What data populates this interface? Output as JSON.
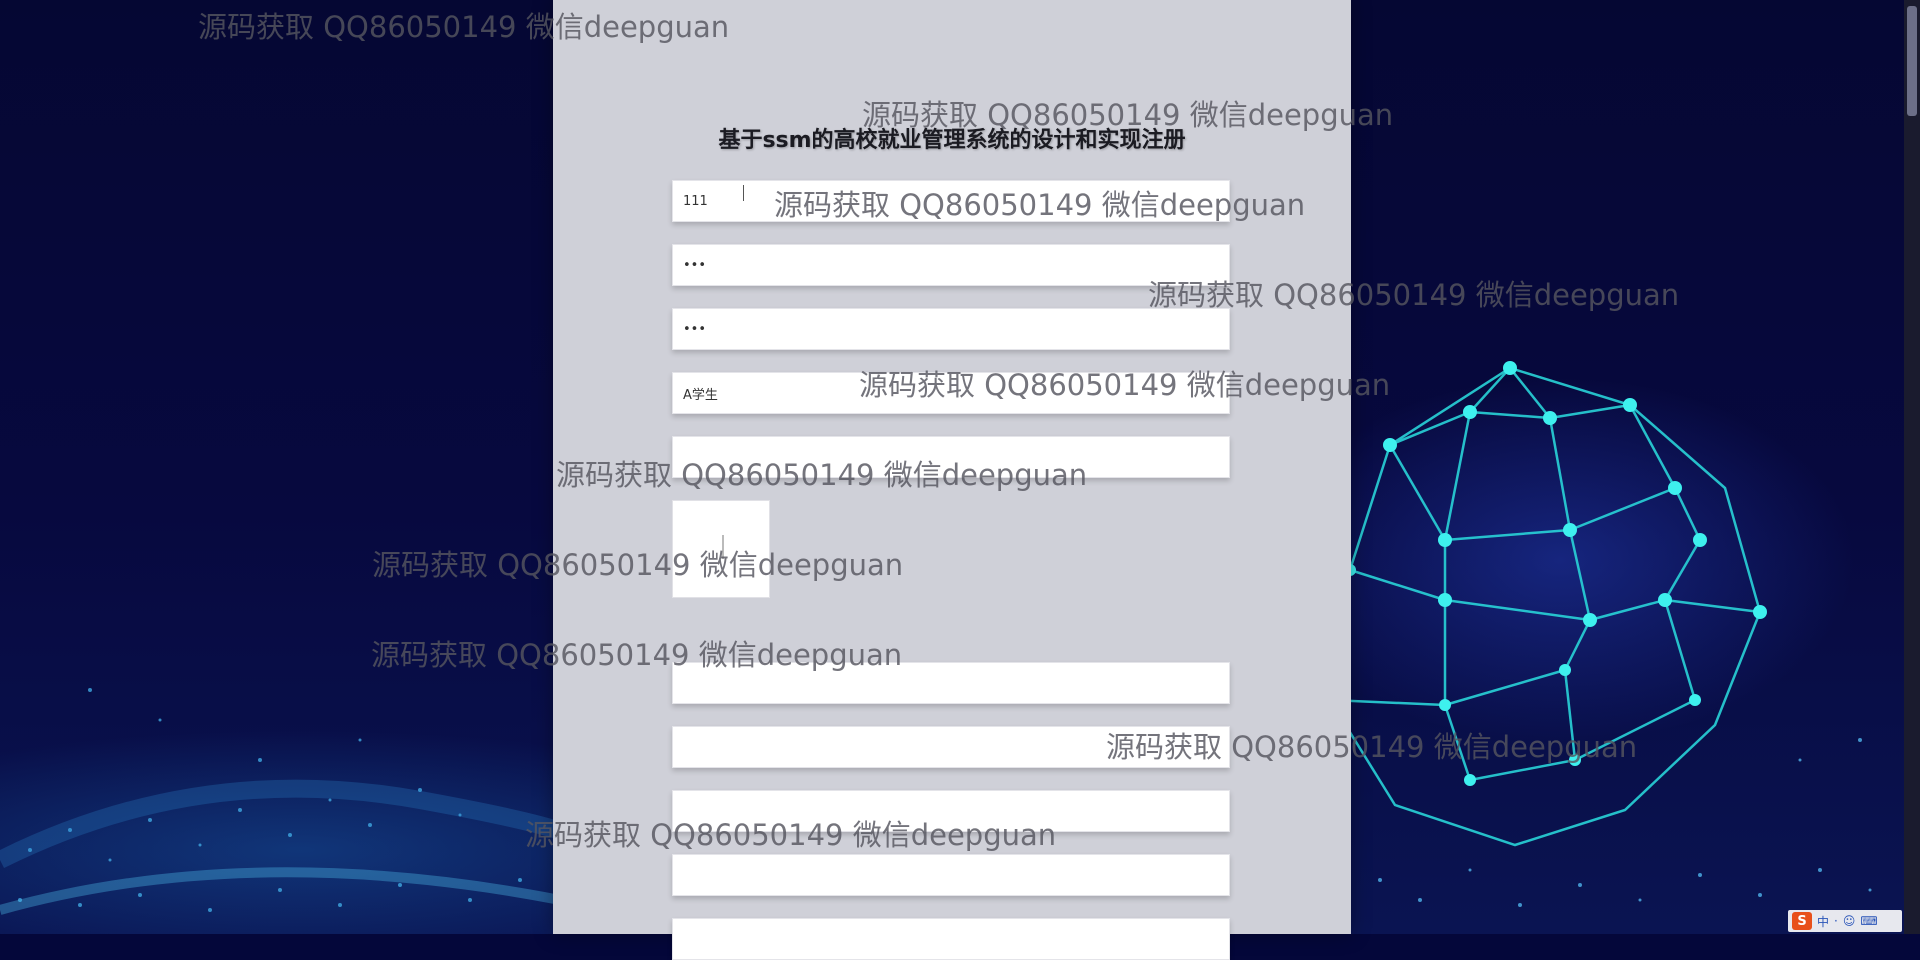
{
  "form": {
    "title": "基于ssm的高校就业管理系统的设计和实现注册",
    "fields": [
      {
        "value": "111"
      },
      {
        "value": "•••"
      },
      {
        "value": "•••"
      },
      {
        "value": "A学生"
      },
      {
        "value": ""
      }
    ],
    "lower_fields": [
      {
        "placeholder": ""
      },
      {
        "placeholder": ""
      },
      {
        "placeholder": ""
      },
      {
        "placeholder": ""
      },
      {
        "placeholder": ""
      }
    ]
  },
  "watermark": {
    "text": "源码获取 QQ86050149 微信deepguan"
  },
  "ime": {
    "logo": "S",
    "mode": "中",
    "icons": [
      "punctuation-icon",
      "emoji-icon",
      "keyboard-icon"
    ]
  }
}
